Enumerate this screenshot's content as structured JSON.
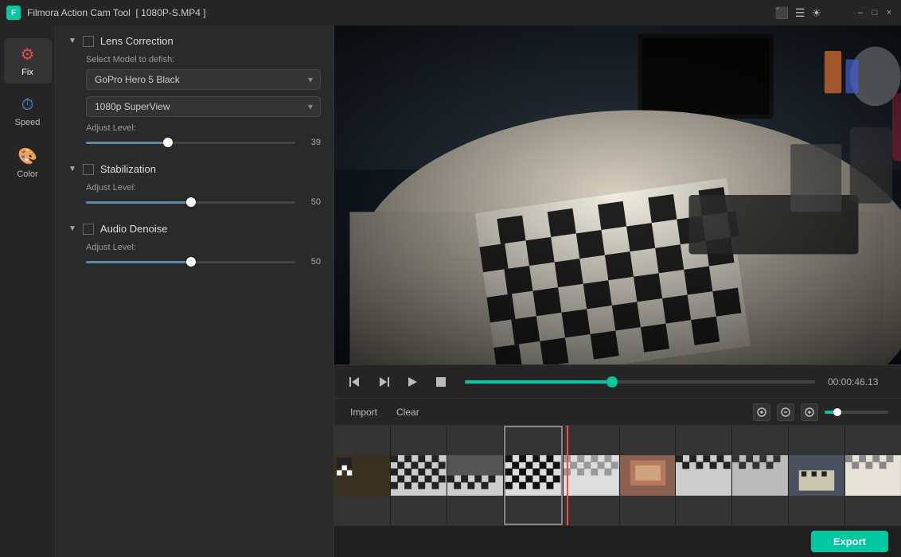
{
  "titlebar": {
    "appTitle": "Filmora Action Cam Tool",
    "filename": "[ 1080P-S.MP4 ]",
    "winMin": "–",
    "winMax": "□",
    "winClose": "×"
  },
  "sidebar": {
    "items": [
      {
        "id": "fix",
        "label": "Fix",
        "icon": "⚙",
        "active": true
      },
      {
        "id": "speed",
        "label": "Speed",
        "icon": "⏱"
      },
      {
        "id": "color",
        "label": "Color",
        "icon": "🎨"
      }
    ]
  },
  "panel": {
    "lensCorrection": {
      "title": "Lens Correction",
      "fieldLabel": "Select Model to defish:",
      "model": "GoPro Hero 5 Black",
      "view": "1080p SuperView",
      "adjustLabel": "Adjust Level:",
      "adjustValue": "39",
      "adjustPercent": 39
    },
    "stabilization": {
      "title": "Stabilization",
      "adjustLabel": "Adjust Level:",
      "adjustValue": "50",
      "adjustPercent": 50
    },
    "audioDenoise": {
      "title": "Audio Denoise",
      "adjustLabel": "Adjust Level:",
      "adjustValue": "50",
      "adjustPercent": 50
    }
  },
  "player": {
    "skipStart": "⏮",
    "skipEnd": "⏭",
    "play": "▶",
    "stop": "⬛",
    "timeDisplay": "00:00:46.13",
    "progressPercent": 42
  },
  "timeline": {
    "importLabel": "Import",
    "clearLabel": "Clear",
    "zoomIn": "+",
    "zoomOut": "–",
    "playheadLeft": 41,
    "frames": [
      {
        "type": "office"
      },
      {
        "type": "checker"
      },
      {
        "type": "mix"
      },
      {
        "type": "checker-dark"
      },
      {
        "type": "checker-light"
      },
      {
        "type": "office2"
      },
      {
        "type": "checker"
      },
      {
        "type": "checker-dark"
      },
      {
        "type": "office"
      },
      {
        "type": "checker-light"
      }
    ]
  },
  "footer": {
    "exportLabel": "Export"
  }
}
